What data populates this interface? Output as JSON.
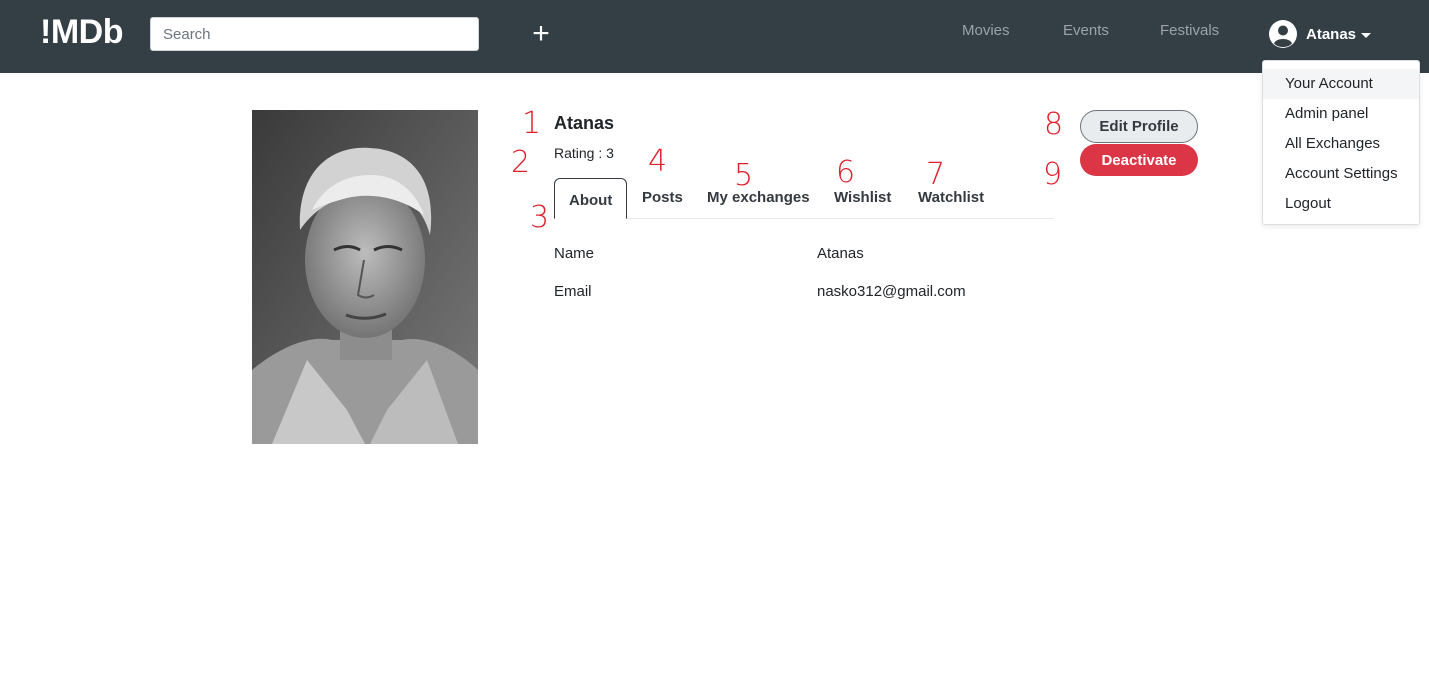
{
  "header": {
    "brand": "!MDb",
    "search_placeholder": "Search",
    "add_symbol": "+",
    "nav": [
      "Movies",
      "Events",
      "Festivals"
    ],
    "user_name": "Atanas"
  },
  "dropdown": {
    "items": [
      "Your Account",
      "Admin panel",
      "All Exchanges",
      "Account Settings",
      "Logout"
    ]
  },
  "profile": {
    "name": "Atanas",
    "rating": "Rating : 3",
    "tabs": [
      "About",
      "Posts",
      "My exchanges",
      "Wishlist",
      "Watchlist"
    ],
    "fields": [
      {
        "label": "Name",
        "value": "Atanas"
      },
      {
        "label": "Email",
        "value": "nasko312@gmail.com"
      }
    ],
    "edit_label": "Edit Profile",
    "deactivate_label": "Deactivate"
  },
  "annotations": [
    "1",
    "2",
    "3",
    "4",
    "5",
    "6",
    "7",
    "8",
    "9"
  ],
  "colors": {
    "navbar": "#343f45",
    "danger": "#dc3545",
    "annotation": "#e0202a"
  }
}
